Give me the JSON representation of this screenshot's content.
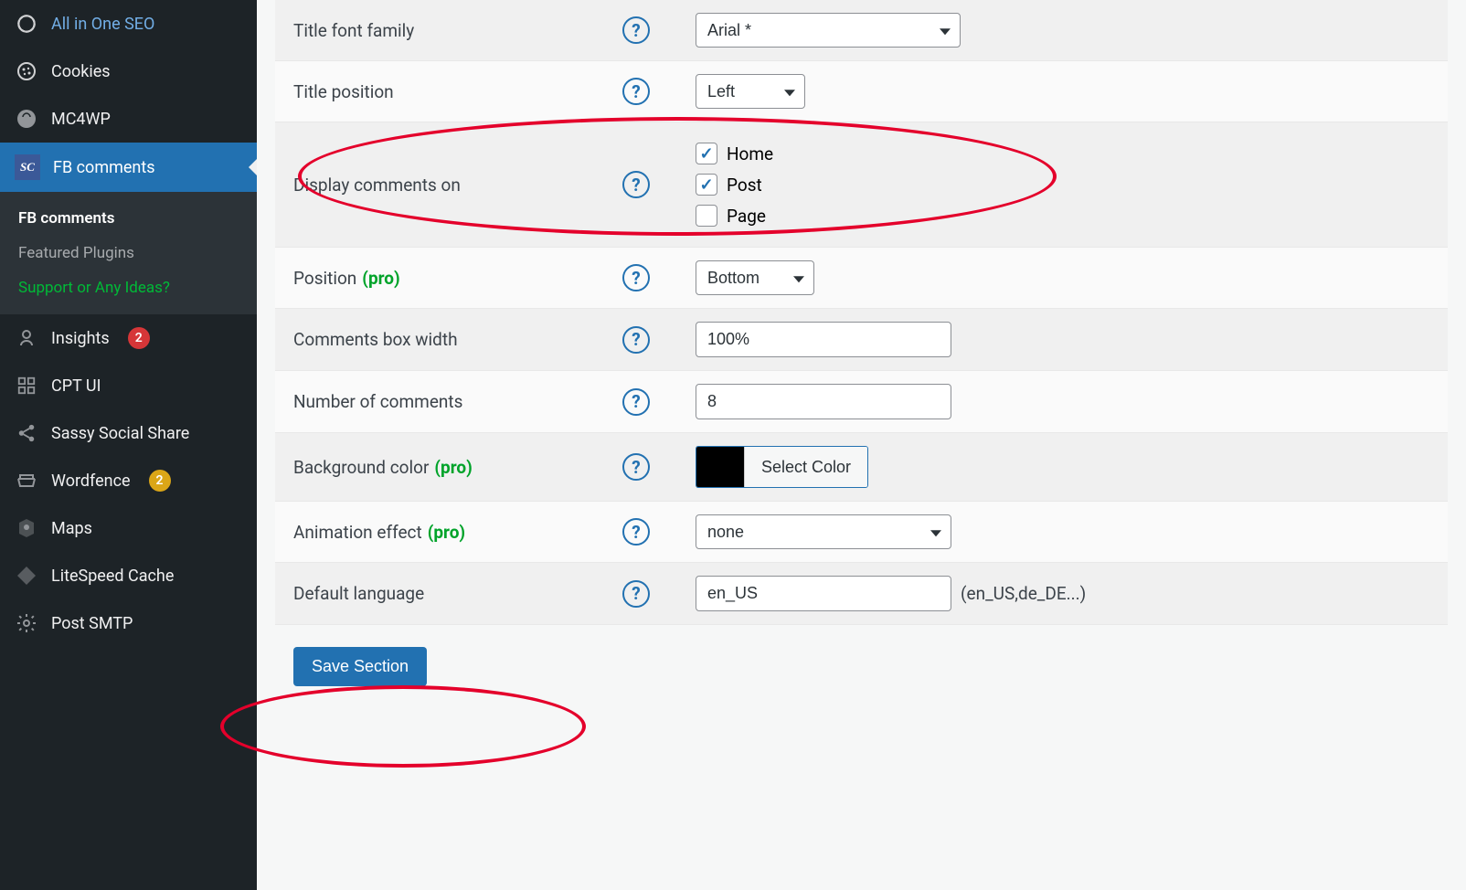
{
  "sidebar": {
    "items": [
      {
        "key": "all-in-one-seo",
        "label": "All in One SEO",
        "icon": "seo"
      },
      {
        "key": "cookies",
        "label": "Cookies",
        "icon": "cookie"
      },
      {
        "key": "mc4wp",
        "label": "MC4WP",
        "icon": "mailchimp"
      },
      {
        "key": "fb-comments",
        "label": "FB comments",
        "icon": "sc",
        "active": true
      },
      {
        "key": "insights",
        "label": "Insights",
        "icon": "insights",
        "badge": "2",
        "badgeColor": "red"
      },
      {
        "key": "cpt-ui",
        "label": "CPT UI",
        "icon": "grid"
      },
      {
        "key": "sassy-social",
        "label": "Sassy Social Share",
        "icon": "share"
      },
      {
        "key": "wordfence",
        "label": "Wordfence",
        "icon": "wordfence",
        "badge": "2",
        "badgeColor": "orange"
      },
      {
        "key": "maps",
        "label": "Maps",
        "icon": "maps"
      },
      {
        "key": "litespeed",
        "label": "LiteSpeed Cache",
        "icon": "litespeed"
      },
      {
        "key": "post-smtp",
        "label": "Post SMTP",
        "icon": "gear"
      }
    ],
    "submenu": [
      {
        "label": "FB comments",
        "active": true
      },
      {
        "label": "Featured Plugins"
      },
      {
        "label": "Support or Any Ideas?",
        "support": true
      }
    ]
  },
  "settings": {
    "title_font_family": {
      "label": "Title font family",
      "value": "Arial *"
    },
    "title_position": {
      "label": "Title position",
      "value": "Left"
    },
    "display_on": {
      "label": "Display comments on",
      "options": [
        {
          "label": "Home",
          "checked": true
        },
        {
          "label": "Post",
          "checked": true
        },
        {
          "label": "Page",
          "checked": false
        }
      ]
    },
    "position": {
      "label": "Position",
      "pro_tag": "(pro)",
      "value": "Bottom"
    },
    "box_width": {
      "label": "Comments box width",
      "value": "100%"
    },
    "num_comments": {
      "label": "Number of comments",
      "value": "8"
    },
    "bg_color": {
      "label": "Background color",
      "pro_tag": "(pro)",
      "swatch": "#000000",
      "button": "Select Color"
    },
    "animation": {
      "label": "Animation effect",
      "pro_tag": "(pro)",
      "value": "none"
    },
    "language": {
      "label": "Default language",
      "value": "en_US",
      "hint": "(en_US,de_DE...)"
    }
  },
  "buttons": {
    "save": "Save Section"
  }
}
